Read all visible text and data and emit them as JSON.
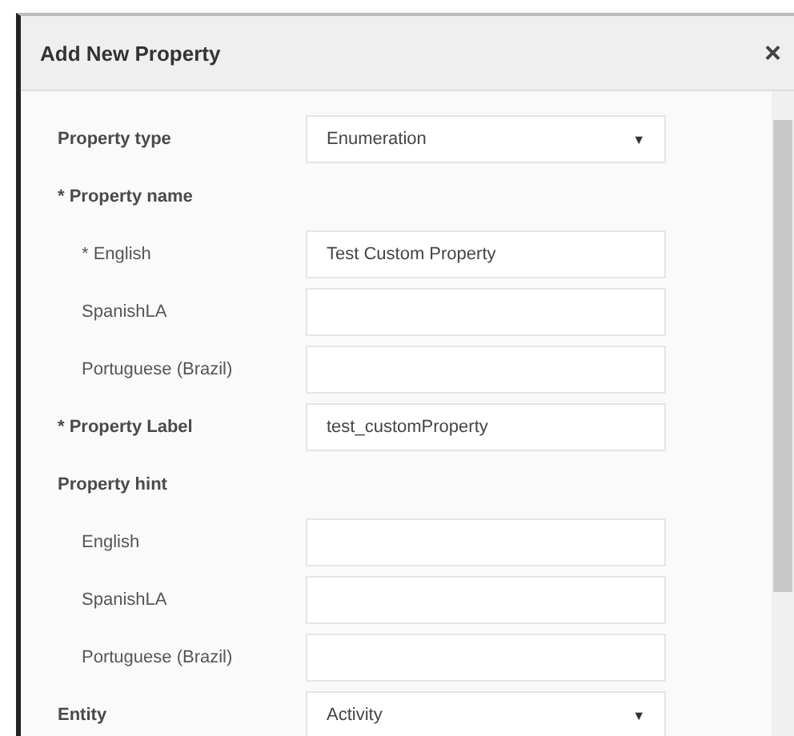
{
  "dialog": {
    "title": "Add New Property",
    "close": "×"
  },
  "rows": [
    {
      "kind": "select",
      "label": "Property type",
      "value": "Enumeration",
      "caret": "▼"
    },
    {
      "kind": "group",
      "label": "* Property name",
      "children": [
        {
          "kind": "text",
          "label": "* English",
          "value": "Test Custom Property"
        },
        {
          "kind": "text",
          "label": "SpanishLA"
        },
        {
          "kind": "text",
          "label": "Portuguese (Brazil)"
        }
      ]
    },
    {
      "kind": "text",
      "label": "* Property Label",
      "value": "test_customProperty"
    },
    {
      "kind": "group",
      "label": "Property hint",
      "children": [
        {
          "kind": "text",
          "label": "English"
        },
        {
          "kind": "text",
          "label": "SpanishLA"
        },
        {
          "kind": "text",
          "label": "Portuguese (Brazil)"
        }
      ]
    },
    {
      "kind": "select",
      "label": "Entity",
      "value": "Activity",
      "caret": "▼"
    }
  ]
}
